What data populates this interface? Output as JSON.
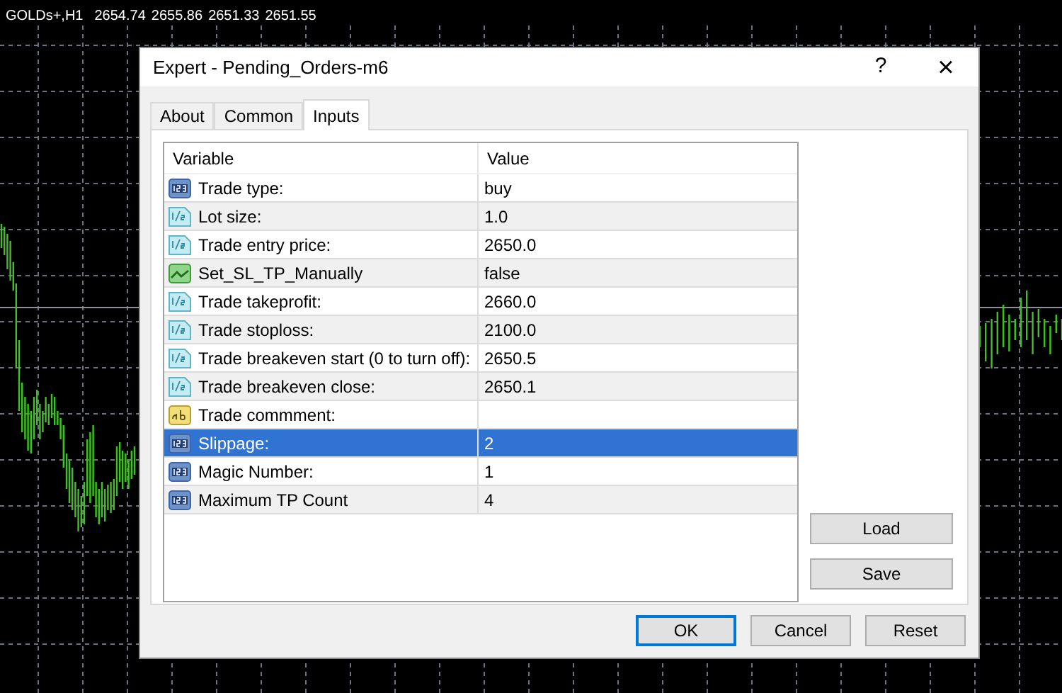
{
  "chart": {
    "symbol": "GOLDs+,H1",
    "prices": [
      "2654.74",
      "2655.86",
      "2651.33",
      "2651.55"
    ]
  },
  "dialog": {
    "title": "Expert - Pending_Orders-m6",
    "help": "?",
    "close": "×"
  },
  "tabs": [
    {
      "label": "About",
      "selected": false
    },
    {
      "label": "Common",
      "selected": false
    },
    {
      "label": "Inputs",
      "selected": true
    }
  ],
  "table": {
    "columns": [
      "Variable",
      "Value"
    ],
    "rows": [
      {
        "kind": "integer",
        "name": "Trade type:",
        "value": "buy",
        "selected": false
      },
      {
        "kind": "double",
        "name": "Lot size:",
        "value": "1.0",
        "selected": false
      },
      {
        "kind": "double",
        "name": "Trade entry price:",
        "value": "2650.0",
        "selected": false
      },
      {
        "kind": "bool",
        "name": "Set_SL_TP_Manually",
        "value": "false",
        "selected": false
      },
      {
        "kind": "double",
        "name": "Trade takeprofit:",
        "value": "2660.0",
        "selected": false
      },
      {
        "kind": "double",
        "name": "Trade stoploss:",
        "value": "2100.0",
        "selected": false
      },
      {
        "kind": "double",
        "name": "Trade breakeven start (0 to turn off):",
        "value": "2650.5",
        "selected": false
      },
      {
        "kind": "double",
        "name": "Trade breakeven close:",
        "value": "2650.1",
        "selected": false
      },
      {
        "kind": "string",
        "name": "Trade commment:",
        "selected": false
      },
      {
        "kind": "integer",
        "name": "Slippage:",
        "value": "2",
        "selected": true
      },
      {
        "kind": "integer",
        "name": "Magic Number:",
        "value": "1",
        "selected": false
      },
      {
        "kind": "integer",
        "name": "Maximum TP Count",
        "value": "4",
        "selected": false
      }
    ]
  },
  "side_buttons": [
    "Load",
    "Save"
  ],
  "buttons": [
    {
      "label": "OK",
      "default": true
    },
    {
      "label": "Cancel",
      "default": false
    },
    {
      "label": "Reset",
      "default": false
    }
  ]
}
